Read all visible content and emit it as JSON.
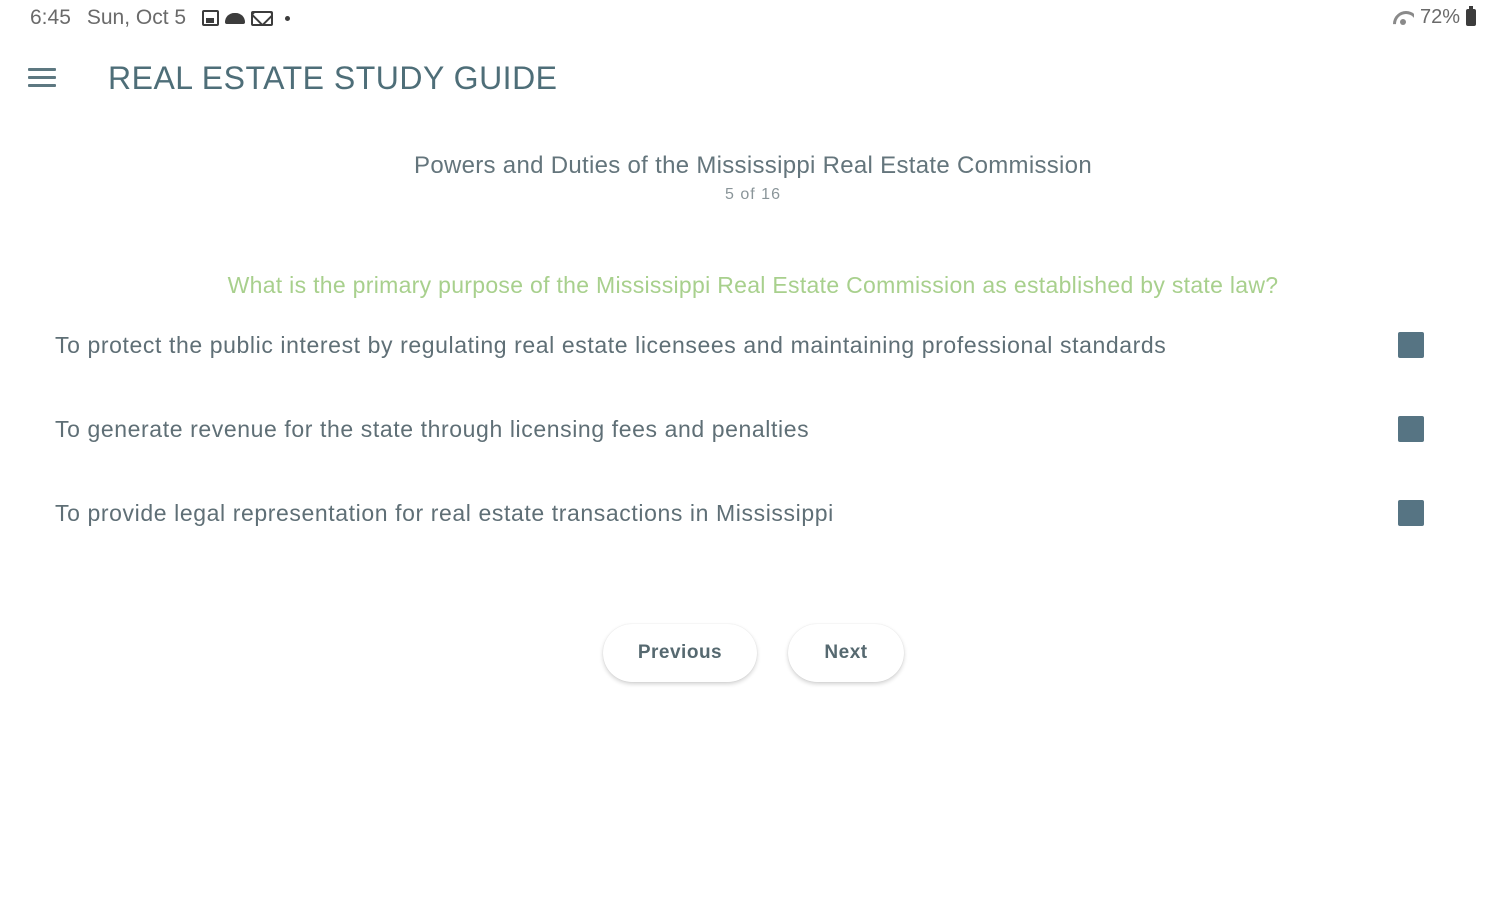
{
  "status_bar": {
    "time": "6:45",
    "date": "Sun, Oct 5",
    "battery": "72%",
    "icons": [
      "photo-icon",
      "cloud-icon",
      "mail-icon",
      "dot-icon",
      "wifi-icon",
      "battery-icon"
    ]
  },
  "app_bar": {
    "menu_icon": "menu-icon",
    "title": "REAL ESTATE STUDY GUIDE"
  },
  "section": {
    "title": "Powers and Duties of the Mississippi Real Estate Commission",
    "progress": "5 of 16"
  },
  "question": {
    "text": "What is the primary purpose of the Mississippi Real Estate Commission as established by state law?"
  },
  "answers": [
    {
      "text": "To protect the public interest by regulating real estate licensees and maintaining professional standards"
    },
    {
      "text": "To generate revenue for the state through licensing fees and penalties"
    },
    {
      "text": "To provide legal representation for real estate transactions in Mississippi"
    }
  ],
  "navigation": {
    "previous_label": "Previous",
    "next_label": "Next"
  },
  "colors": {
    "title": "#4e6e78",
    "question": "#a8d08d",
    "checkbox": "#567483",
    "text": "#5f6f76"
  }
}
